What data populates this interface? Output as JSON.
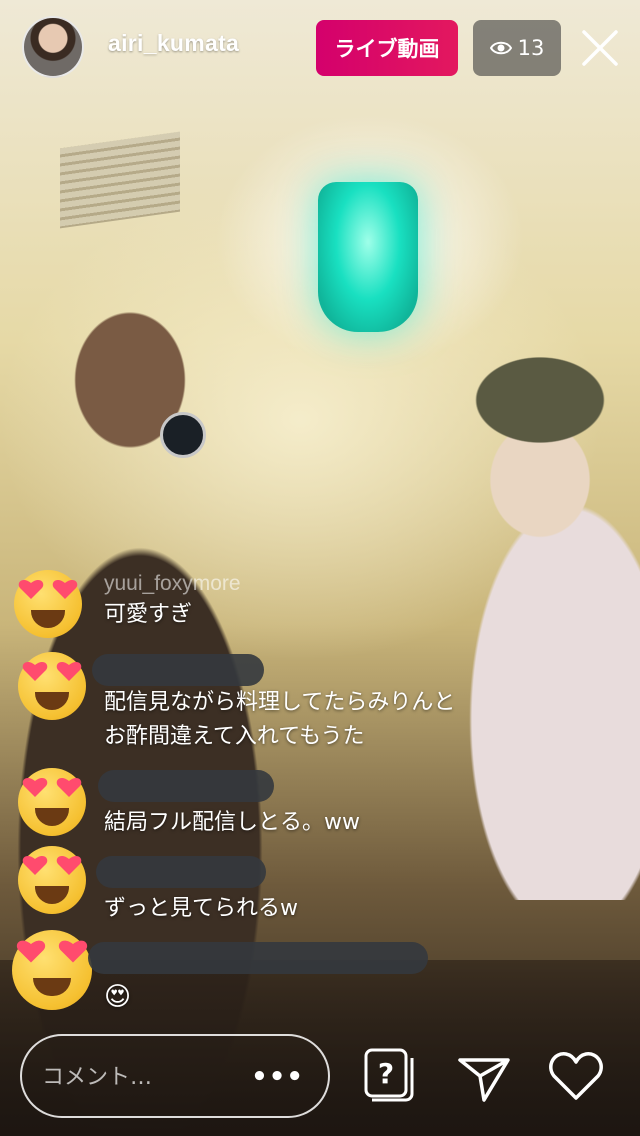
{
  "header": {
    "username": "airi_kumata",
    "live_label": "ライブ動画",
    "viewer_count": "13",
    "live_color": "#d8006a"
  },
  "comments": [
    {
      "user": "yuui_foxymore",
      "text": "可愛すぎ",
      "user_redacted": false
    },
    {
      "user": "",
      "text": "配信見ながら料理してたらみりんと",
      "text2": "お酢間違えて入れてもうた",
      "user_redacted": true
    },
    {
      "user": "",
      "text": "結局フル配信しとる。ww",
      "user_redacted": true
    },
    {
      "user": "",
      "text": "ずっと見てられるw",
      "user_redacted": true
    },
    {
      "user": "",
      "text": "😍",
      "user_redacted": true
    }
  ],
  "composer": {
    "placeholder": "コメント…",
    "more_label": "•••"
  },
  "icons": [
    "eye-icon",
    "close-icon",
    "question-card-icon",
    "send-icon",
    "heart-icon",
    "heart-eyes-emoji"
  ]
}
